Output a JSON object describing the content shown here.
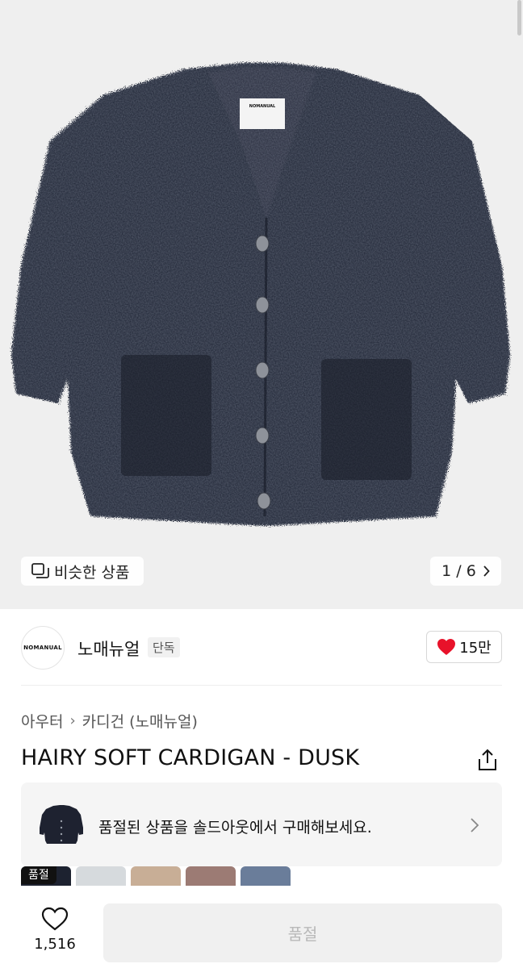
{
  "hero": {
    "similar_label": "비슷한 상품",
    "similar_icon": "similar-items-icon",
    "pager": "1 / 6"
  },
  "brand": {
    "logo_text": "NOMANUAL",
    "name": "노매뉴얼",
    "badge": "단독",
    "likes": "15만",
    "heart_color": "#e8122a"
  },
  "breadcrumb": {
    "category": "아우터",
    "subcategory": "카디건 (노매뉴얼)"
  },
  "product": {
    "title": "HAIRY SOFT CARDIGAN - DUSK"
  },
  "soldout_card": {
    "message": "품절된 상품을 솔드아웃에서 구매해보세요."
  },
  "swatches": [
    {
      "tag": "품절",
      "color": "#1d2230"
    },
    {
      "tag": "",
      "color": "#d6dadd"
    },
    {
      "tag": "",
      "color": "#c8ae96"
    },
    {
      "tag": "",
      "color": "#9c7b74"
    },
    {
      "tag": "",
      "color": "#6a7d9a"
    }
  ],
  "bottom": {
    "wish_count": "1,516",
    "buy_label": "품절"
  }
}
